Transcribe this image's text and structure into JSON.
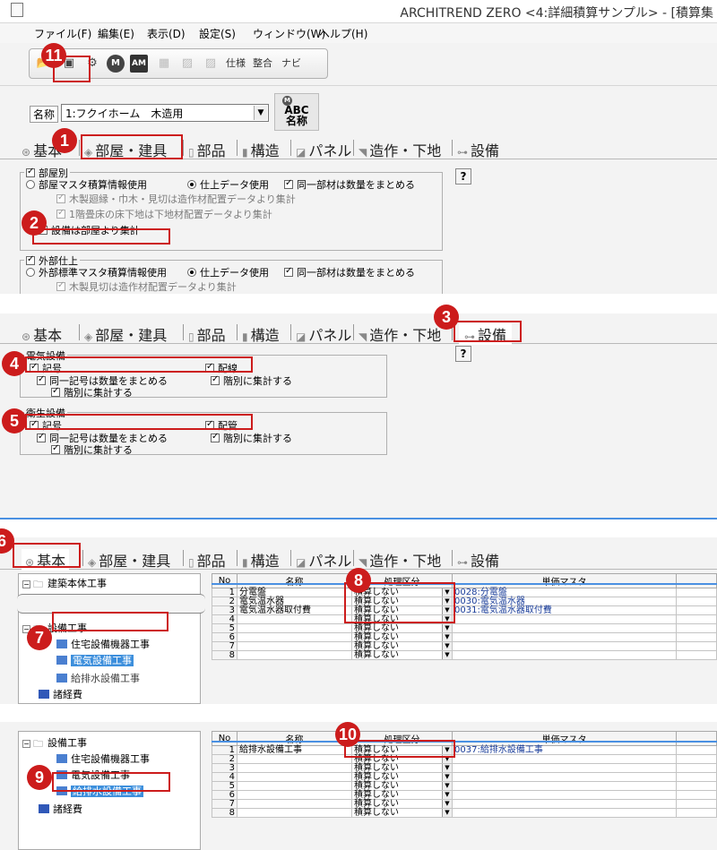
{
  "window": {
    "title": "ARCHITREND ZERO <4:詳細積算サンプル> - [積算集"
  },
  "menu": [
    "ファイル(F)",
    "編集(E)",
    "表示(D)",
    "設定(S)",
    "ウィンドウ(W)",
    "ヘルプ(H)"
  ],
  "toolbar": {
    "m_label": "M",
    "am_label": "AM",
    "spec_label": "仕様",
    "seigo_label": "整合",
    "navi_label": "ナビ"
  },
  "name_field": {
    "label": "名称",
    "value": "1:フクイホーム　木造用",
    "abc_m": "M",
    "abc_label_1": "ABC",
    "abc_label_2": "名称"
  },
  "tabs": [
    "基本",
    "部屋・建具",
    "部品",
    "構造",
    "パネル",
    "造作・下地",
    "設備"
  ],
  "help_label": "?",
  "callouts": [
    "1",
    "2",
    "3",
    "4",
    "5",
    "6",
    "7",
    "8",
    "9",
    "10",
    "11"
  ],
  "panel1": {
    "room_group": "部屋別",
    "room_opt1": "部屋マスタ積算情報使用",
    "room_opt2": "仕上データ使用",
    "room_opt3": "同一部材は数量をまとめる",
    "room_sub1": "木製廻縁・巾木・見切は造作材配置データより集計",
    "room_sub2": "1階畳床の床下地は下地材配置データより集計",
    "room_sub3": "設備は部屋より集計",
    "ext_group": "外部仕上",
    "ext_opt1": "外部標準マスタ積算情報使用",
    "ext_opt2": "仕上データ使用",
    "ext_opt3": "同一部材は数量をまとめる",
    "ext_sub1": "木製見切は造作材配置データより集計"
  },
  "panel2": {
    "elec_group": "電気設備",
    "elec_sym": "記号",
    "elec_wire": "配線",
    "elec_same": "同一記号は数量をまとめる",
    "elec_floor1": "階別に集計する",
    "elec_floor2": "階別に集計する",
    "sani_group": "衛生設備",
    "sani_sym": "記号",
    "sani_pipe": "配管",
    "sani_same": "同一記号は数量をまとめる",
    "sani_floor1": "階別に集計する",
    "sani_floor2": "階別に集計する"
  },
  "grid_headers": {
    "no": "No",
    "name": "名称",
    "kbn": "処理区分",
    "master": "単価マスタ"
  },
  "panel3": {
    "tree": [
      "建築本体工事",
      "設備工事",
      "住宅設備機器工事",
      "電気設備工事",
      "給排水設備工事",
      "諸経費"
    ],
    "rows": [
      {
        "no": "1",
        "name": "分電盤",
        "kbn": "積算しない",
        "master": "0028:分電盤"
      },
      {
        "no": "2",
        "name": "電気温水器",
        "kbn": "積算しない",
        "master": "0030:電気温水器"
      },
      {
        "no": "3",
        "name": "電気温水器取付費",
        "kbn": "積算しない",
        "master": "0031:電気温水器取付費"
      },
      {
        "no": "4",
        "name": "",
        "kbn": "積算しない",
        "master": ""
      },
      {
        "no": "5",
        "name": "",
        "kbn": "積算しない",
        "master": ""
      },
      {
        "no": "6",
        "name": "",
        "kbn": "積算しない",
        "master": ""
      },
      {
        "no": "7",
        "name": "",
        "kbn": "積算しない",
        "master": ""
      },
      {
        "no": "8",
        "name": "",
        "kbn": "積算しない",
        "master": ""
      }
    ]
  },
  "panel4": {
    "tree": [
      "設備工事",
      "住宅設備機器工事",
      "電気設備工事",
      "給排水設備工事",
      "諸経費"
    ],
    "rows": [
      {
        "no": "1",
        "name": "給排水設備工事",
        "kbn": "積算しない",
        "master": "0037:給排水設備工事"
      },
      {
        "no": "2",
        "name": "",
        "kbn": "積算しない",
        "master": ""
      },
      {
        "no": "3",
        "name": "",
        "kbn": "積算しない",
        "master": ""
      },
      {
        "no": "4",
        "name": "",
        "kbn": "積算しない",
        "master": ""
      },
      {
        "no": "5",
        "name": "",
        "kbn": "積算しない",
        "master": ""
      },
      {
        "no": "6",
        "name": "",
        "kbn": "積算しない",
        "master": ""
      },
      {
        "no": "7",
        "name": "",
        "kbn": "積算しない",
        "master": ""
      },
      {
        "no": "8",
        "name": "",
        "kbn": "積算しない",
        "master": ""
      }
    ]
  }
}
